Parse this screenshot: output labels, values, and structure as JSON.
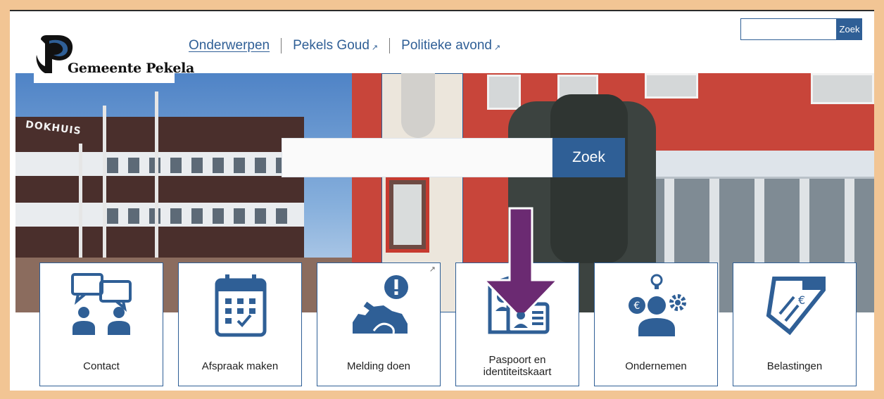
{
  "header": {
    "logo_text": "Gemeente Pekela",
    "nav": [
      {
        "label": "Onderwerpen",
        "external": false
      },
      {
        "label": "Pekels Goud",
        "external": true
      },
      {
        "label": "Politieke avond",
        "external": true
      }
    ],
    "search_button": "Zoek"
  },
  "hero": {
    "building_sign": "DOKHUIS",
    "search_button": "Zoek",
    "arrow_color": "#6b2a72"
  },
  "tiles": [
    {
      "label": "Contact",
      "icon": "contact-chat-icon",
      "external": false
    },
    {
      "label": "Afspraak maken",
      "icon": "calendar-icon",
      "external": false
    },
    {
      "label": "Melding doen",
      "icon": "report-issue-icon",
      "external": true
    },
    {
      "label": "Paspoort en identiteitskaart",
      "icon": "passport-id-icon",
      "external": false
    },
    {
      "label": "Ondernemen",
      "icon": "entrepreneur-icon",
      "external": false
    },
    {
      "label": "Belastingen",
      "icon": "tax-ticket-icon",
      "external": false
    }
  ],
  "colors": {
    "brand_blue": "#2f5f96",
    "frame_border": "#f2c594",
    "arrow": "#6b2a72"
  }
}
